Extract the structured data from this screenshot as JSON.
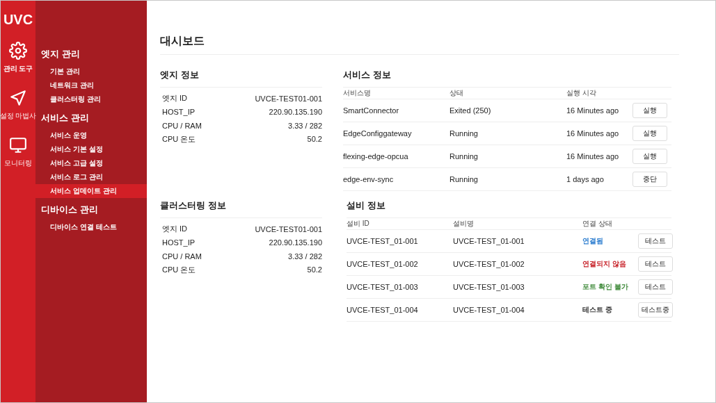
{
  "logo": "UVC",
  "rail": [
    {
      "kind": "gear",
      "label": "관리 도구",
      "selected": true
    },
    {
      "kind": "send",
      "label": "설정 마법사",
      "selected": false
    },
    {
      "kind": "monitor",
      "label": "모니터링",
      "selected": false
    }
  ],
  "menu": [
    {
      "title": "엣지 관리",
      "items": [
        {
          "label": "기본 관리",
          "selected": false
        },
        {
          "label": "네트워크 관리",
          "selected": false
        },
        {
          "label": "클러스터링 관리",
          "selected": false
        }
      ]
    },
    {
      "title": "서비스 관리",
      "items": [
        {
          "label": "서비스 운영",
          "selected": false
        },
        {
          "label": "서비스 기본 설정",
          "selected": false
        },
        {
          "label": "서비스 고급 설정",
          "selected": false
        },
        {
          "label": "서비스 로그 관리",
          "selected": false
        },
        {
          "label": "서비스 업데이트 관리",
          "selected": true
        }
      ]
    },
    {
      "title": "디바이스 관리",
      "items": [
        {
          "label": "디바이스 연결 테스트",
          "selected": false
        }
      ]
    }
  ],
  "page_title": "대시보드",
  "edge_info": {
    "title": "엣지 정보",
    "rows": [
      {
        "label": "엣지 ID",
        "value": "UVCE-TEST01-001"
      },
      {
        "label": "HOST_IP",
        "value": "220.90.135.190"
      },
      {
        "label": "CPU / RAM",
        "value": "3.33 / 282"
      },
      {
        "label": "CPU 온도",
        "value": "50.2"
      }
    ]
  },
  "cluster_info": {
    "title": "클러스터링 정보",
    "rows": [
      {
        "label": "엣지 ID",
        "value": "UVCE-TEST01-001"
      },
      {
        "label": "HOST_IP",
        "value": "220.90.135.190"
      },
      {
        "label": "CPU / RAM",
        "value": "3.33 / 282"
      },
      {
        "label": "CPU 온도",
        "value": "50.2"
      }
    ]
  },
  "service_info": {
    "title": "서비스 정보",
    "columns": [
      "서비스명",
      "상태",
      "실행 시각"
    ],
    "rows": [
      {
        "name": "SmartConnector",
        "status": "Exited (250)",
        "time": "16 Minutes ago",
        "button": "실행"
      },
      {
        "name": "EdgeConfiggateway",
        "status": "Running",
        "time": "16 Minutes ago",
        "button": "실행"
      },
      {
        "name": "flexing-edge-opcua",
        "status": "Running",
        "time": "16 Minutes ago",
        "button": "실행"
      },
      {
        "name": "edge-env-sync",
        "status": "Running",
        "time": "1 days ago",
        "button": "중단"
      }
    ]
  },
  "device_info": {
    "title": "설비 정보",
    "columns": [
      "설비 ID",
      "설비명",
      "연결 상태"
    ],
    "rows": [
      {
        "id": "UVCE-TEST_01-001",
        "name": "UVCE-TEST_01-001",
        "status": "연결됨",
        "color": "#2f7fd0",
        "button": "테스트"
      },
      {
        "id": "UVCE-TEST_01-002",
        "name": "UVCE-TEST_01-002",
        "status": "연결되지 않음",
        "color": "#c8242b",
        "button": "테스트"
      },
      {
        "id": "UVCE-TEST_01-003",
        "name": "UVCE-TEST_01-003",
        "status": "포트 확인 불가",
        "color": "#3f8a3a",
        "button": "테스트"
      },
      {
        "id": "UVCE-TEST_01-004",
        "name": "UVCE-TEST_01-004",
        "status": "테스트 중",
        "color": "#333333",
        "button": "테스트중"
      }
    ]
  }
}
